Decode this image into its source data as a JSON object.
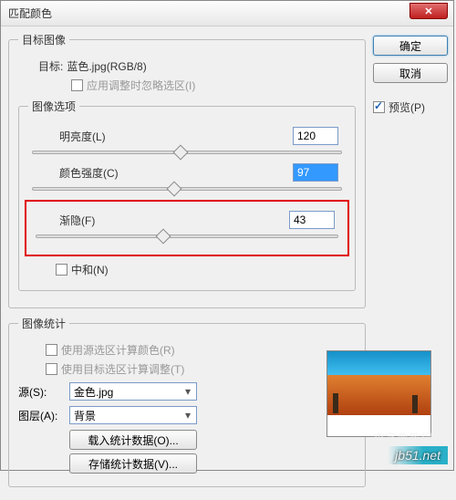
{
  "title": "匹配颜色",
  "buttons": {
    "ok": "确定",
    "cancel": "取消"
  },
  "preview": {
    "label": "预览(P)",
    "checked": true
  },
  "target_group": {
    "legend": "目标图像",
    "target_label": "目标:",
    "target_value": "蓝色.jpg(RGB/8)",
    "ignore_sel": {
      "label": "应用调整时忽略选区(I)",
      "checked": false
    },
    "options_legend": "图像选项",
    "luminance": {
      "label": "明亮度(L)",
      "value": "120",
      "pos": 48
    },
    "intensity": {
      "label": "颜色强度(C)",
      "value": "97",
      "pos": 46
    },
    "fade": {
      "label": "渐隐(F)",
      "value": "43",
      "pos": 42
    },
    "neutralize": {
      "label": "中和(N)",
      "checked": false
    }
  },
  "stats_group": {
    "legend": "图像统计",
    "use_src_sel": {
      "label": "使用源选区计算颜色(R)",
      "checked": false
    },
    "use_tgt_sel": {
      "label": "使用目标选区计算调整(T)",
      "checked": false
    },
    "source": {
      "label": "源(S):",
      "value": "金色.jpg"
    },
    "layer": {
      "label": "图层(A):",
      "value": "背景"
    },
    "load_btn": "载入统计数据(O)...",
    "save_btn": "存储统计数据(V)..."
  },
  "watermark": {
    "site": "jb51.net",
    "cn": "查字典教程网"
  }
}
